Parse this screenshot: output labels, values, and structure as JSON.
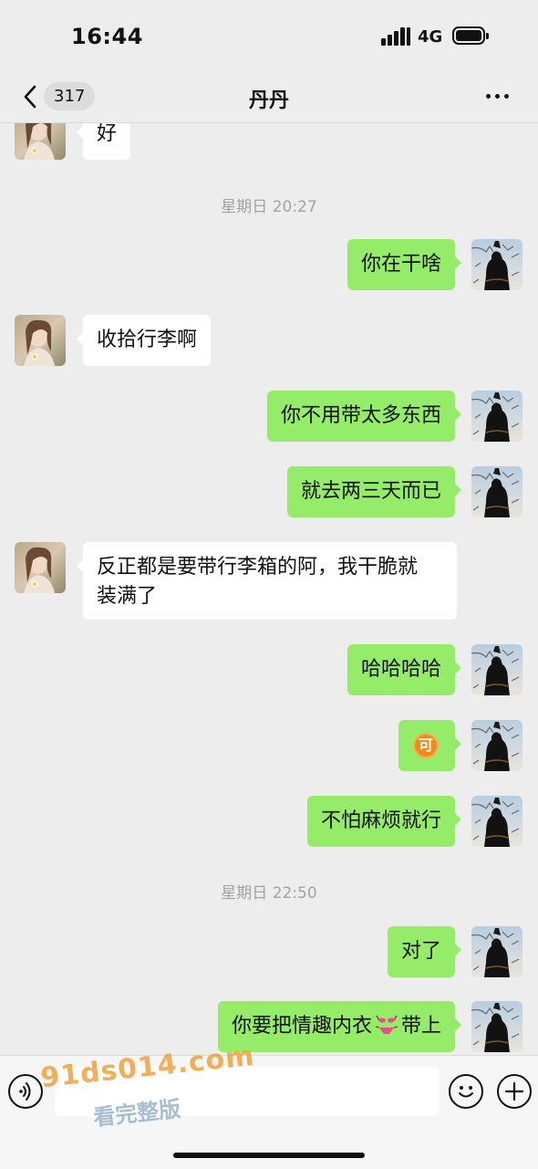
{
  "status_bar": {
    "time": "16:44",
    "network": "4G"
  },
  "nav": {
    "unread_count": "317",
    "title": "丹丹"
  },
  "messages": [
    {
      "side": "left",
      "text": "好"
    },
    {
      "timestamp": "星期日 20:27"
    },
    {
      "side": "right",
      "text": "你在干啥"
    },
    {
      "side": "left",
      "text": "收拾行李啊"
    },
    {
      "side": "right",
      "text": "你不用带太多东西"
    },
    {
      "side": "right",
      "text": "就去两三天而已"
    },
    {
      "side": "left",
      "line1": "反正都是要带行李箱的阿，我干脆就",
      "line2": "装满了"
    },
    {
      "side": "right",
      "text": "哈哈哈哈"
    },
    {
      "side": "right",
      "emoji": "可"
    },
    {
      "side": "right",
      "text": "不怕麻烦就行"
    },
    {
      "timestamp": "星期日 22:50"
    },
    {
      "side": "right",
      "text": "对了"
    },
    {
      "side": "right",
      "text_before": "你要把情趣内衣",
      "text_after": "带上",
      "inline_icon": "bikini-icon"
    }
  ],
  "watermark": {
    "main": "91ds014.com",
    "sub": "看完整版"
  },
  "colors": {
    "background": "#ededed",
    "bubble_right": "#95ec69",
    "bubble_left": "#ffffff",
    "timestamp": "#a3a3a3"
  }
}
